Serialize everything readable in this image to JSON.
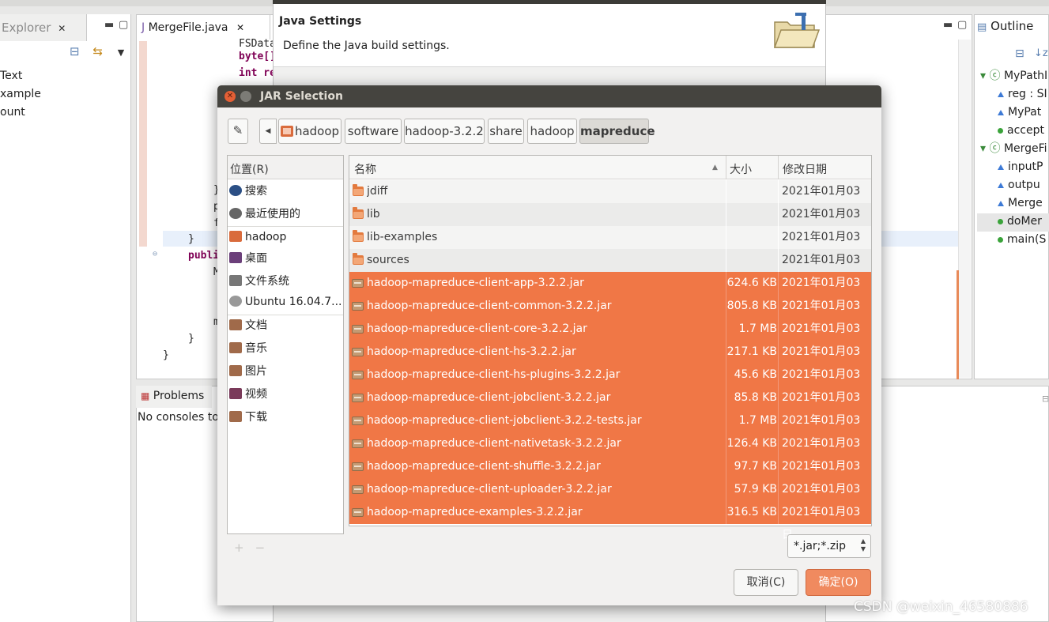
{
  "eclipse": {
    "explorer_tab": "Explorer",
    "explorer_items": [
      "Text",
      "xample",
      "ount"
    ],
    "editor_tab": "MergeFile.java",
    "code": [
      {
        "text": "FSDataI",
        "kw": false
      },
      {
        "text": "byte[]",
        "kw": true
      },
      {
        "text": "int re",
        "kw": true
      },
      {
        "text": "}",
        "kw": false
      },
      {
        "text": "public",
        "kw": true
      }
    ],
    "outline_title": "Outline",
    "outline_items": [
      {
        "label": "MyPathI",
        "kind": "class"
      },
      {
        "label": "reg : SI",
        "kind": "field"
      },
      {
        "label": "MyPat",
        "kind": "ctor"
      },
      {
        "label": "accept",
        "kind": "method"
      },
      {
        "label": "MergeFi",
        "kind": "class"
      },
      {
        "label": "inputP",
        "kind": "field"
      },
      {
        "label": "outpu",
        "kind": "field"
      },
      {
        "label": "Merge",
        "kind": "ctor"
      },
      {
        "label": "doMer",
        "kind": "method",
        "selected": true
      },
      {
        "label": "main(S",
        "kind": "method"
      }
    ],
    "problems_tab": "Problems",
    "console_message": "No consoles to"
  },
  "java_settings": {
    "title": "Java Settings",
    "description": "Define the Java build settings."
  },
  "dialog": {
    "title": "JAR Selection",
    "close_icon": "close-icon",
    "breadcrumbs": [
      "hadoop",
      "software",
      "hadoop-3.2.2",
      "share",
      "hadoop",
      "mapreduce"
    ],
    "places_header": "位置(R)",
    "places": [
      {
        "label": "搜索",
        "icon": "search-icon"
      },
      {
        "label": "最近使用的",
        "icon": "recent-icon"
      },
      {
        "label": "hadoop",
        "icon": "home-icon"
      },
      {
        "label": "桌面",
        "icon": "desktop-icon"
      },
      {
        "label": "文件系统",
        "icon": "drive-icon"
      },
      {
        "label": "Ubuntu 16.04.7...",
        "icon": "disc-icon"
      },
      {
        "label": "文档",
        "icon": "documents-icon"
      },
      {
        "label": "音乐",
        "icon": "music-icon"
      },
      {
        "label": "图片",
        "icon": "pictures-icon"
      },
      {
        "label": "视频",
        "icon": "videos-icon"
      },
      {
        "label": "下载",
        "icon": "downloads-icon"
      }
    ],
    "columns": {
      "name": "名称",
      "size": "大小",
      "modified": "修改日期"
    },
    "files": [
      {
        "name": "jdiff",
        "type": "folder",
        "size": "",
        "date": "2021年01月03日",
        "selected": false
      },
      {
        "name": "lib",
        "type": "folder",
        "size": "",
        "date": "2021年01月03日",
        "selected": false
      },
      {
        "name": "lib-examples",
        "type": "folder",
        "size": "",
        "date": "2021年01月03日",
        "selected": false
      },
      {
        "name": "sources",
        "type": "folder",
        "size": "",
        "date": "2021年01月03日",
        "selected": false
      },
      {
        "name": "hadoop-mapreduce-client-app-3.2.2.jar",
        "type": "jar",
        "size": "624.6 KB",
        "date": "2021年01月03日",
        "selected": true
      },
      {
        "name": "hadoop-mapreduce-client-common-3.2.2.jar",
        "type": "jar",
        "size": "805.8 KB",
        "date": "2021年01月03日",
        "selected": true
      },
      {
        "name": "hadoop-mapreduce-client-core-3.2.2.jar",
        "type": "jar",
        "size": "1.7 MB",
        "date": "2021年01月03日",
        "selected": true
      },
      {
        "name": "hadoop-mapreduce-client-hs-3.2.2.jar",
        "type": "jar",
        "size": "217.1 KB",
        "date": "2021年01月03日",
        "selected": true
      },
      {
        "name": "hadoop-mapreduce-client-hs-plugins-3.2.2.jar",
        "type": "jar",
        "size": "45.6 KB",
        "date": "2021年01月03日",
        "selected": true
      },
      {
        "name": "hadoop-mapreduce-client-jobclient-3.2.2.jar",
        "type": "jar",
        "size": "85.8 KB",
        "date": "2021年01月03日",
        "selected": true
      },
      {
        "name": "hadoop-mapreduce-client-jobclient-3.2.2-tests.jar",
        "type": "jar",
        "size": "1.7 MB",
        "date": "2021年01月03日",
        "selected": true
      },
      {
        "name": "hadoop-mapreduce-client-nativetask-3.2.2.jar",
        "type": "jar",
        "size": "126.4 KB",
        "date": "2021年01月03日",
        "selected": true
      },
      {
        "name": "hadoop-mapreduce-client-shuffle-3.2.2.jar",
        "type": "jar",
        "size": "97.7 KB",
        "date": "2021年01月03日",
        "selected": true
      },
      {
        "name": "hadoop-mapreduce-client-uploader-3.2.2.jar",
        "type": "jar",
        "size": "57.9 KB",
        "date": "2021年01月03日",
        "selected": true
      },
      {
        "name": "hadoop-mapreduce-examples-3.2.2.jar",
        "type": "jar",
        "size": "316.5 KB",
        "date": "2021年01月03日",
        "selected": true
      }
    ],
    "filter": "*.jar;*.zip",
    "cancel_label": "取消(C)",
    "ok_label": "确定(O)"
  },
  "watermark": "CSDN @weixin_46580886",
  "colors": {
    "selection": "#f07746",
    "ok_button": "#f08a5f",
    "titlebar": "#45443f"
  }
}
